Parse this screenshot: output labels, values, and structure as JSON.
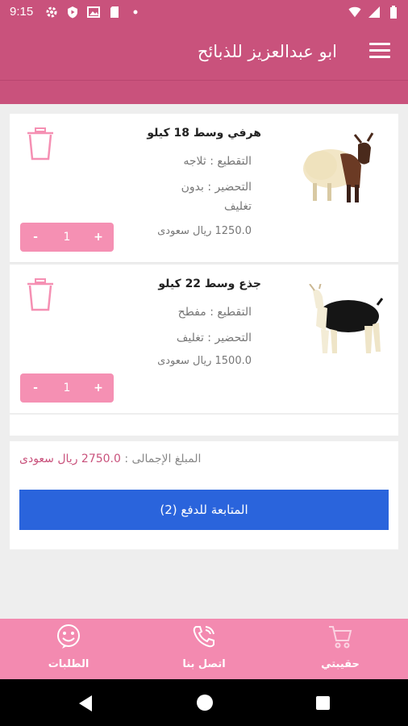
{
  "status_bar": {
    "time": "9:15"
  },
  "app_bar": {
    "title": "ابو عبدالعزيز للذبائح"
  },
  "cart_items": [
    {
      "title": "هرفي وسط 18 كيلو",
      "cutting": "التقطيع : ثلاجه",
      "preparation_1": "التحضير : بدون",
      "preparation_2": "تغليف",
      "price": "1250.0 ريال سعودى",
      "qty": "1",
      "minus": "-",
      "plus": "+"
    },
    {
      "title": "جذع وسط 22 كيلو",
      "cutting": "التقطيع : مفطح",
      "preparation": "التحضير : تغليف",
      "price": "1500.0 ريال سعودى",
      "qty": "1",
      "minus": "-",
      "plus": "+"
    }
  ],
  "total": {
    "label": "المبلغ الإجمالى :",
    "value": "2750.0 ريال سعودى"
  },
  "checkout_label": "المتابعة للدفع (2)",
  "bottom_nav": {
    "orders": "الطلبات",
    "contact": "اتصل بنا",
    "cart": "حقيبتي"
  },
  "colors": {
    "primary": "#c9527c",
    "stepper": "#f590b3",
    "checkout": "#2a64dc",
    "bottom_nav": "#f38ab0"
  }
}
